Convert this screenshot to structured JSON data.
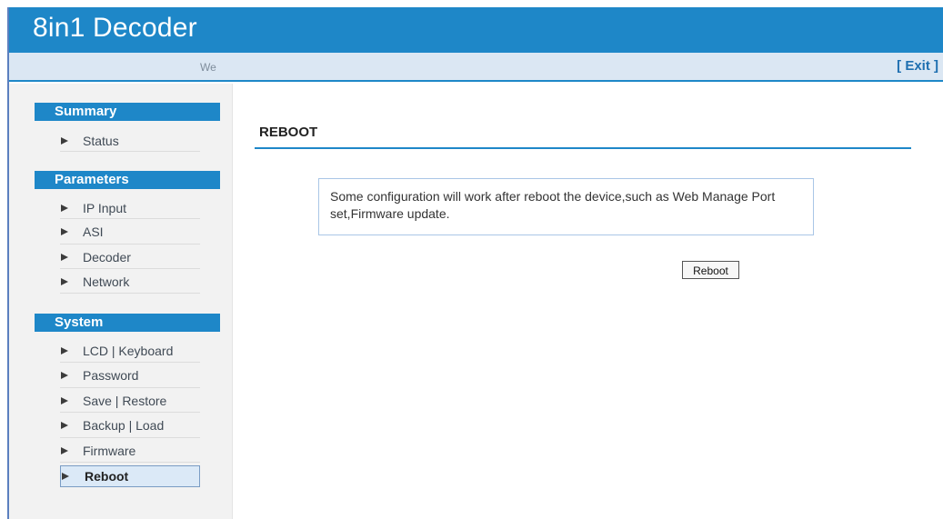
{
  "app": {
    "title": "8in1 Decoder",
    "welcome": "We",
    "exit_label": "[ Exit ]"
  },
  "sidebar": {
    "sections": [
      {
        "heading": "Summary",
        "items": [
          "Status"
        ]
      },
      {
        "heading": "Parameters",
        "items": [
          "IP Input",
          "ASI",
          "Decoder",
          "Network"
        ]
      },
      {
        "heading": "System",
        "items": [
          "LCD | Keyboard",
          "Password",
          "Save | Restore",
          "Backup | Load",
          "Firmware",
          "Reboot"
        ]
      }
    ],
    "active_item": "Reboot"
  },
  "main": {
    "title": "REBOOT",
    "notice": "Some configuration will work after reboot the device,such as Web Manage Port set,Firmware update.",
    "reboot_button": "Reboot"
  },
  "colors": {
    "accent": "#1e87c8",
    "subbar": "#dbe7f3",
    "sidebar_bg": "#f2f2f2"
  }
}
